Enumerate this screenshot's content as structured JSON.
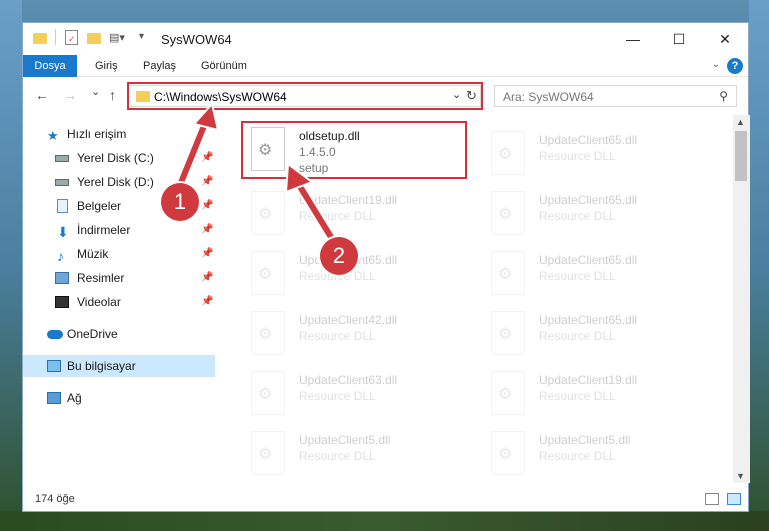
{
  "window": {
    "title": "SysWOW64",
    "minimize": "—",
    "maximize": "☐",
    "close": "✕"
  },
  "ribbon": {
    "tabs": [
      "Dosya",
      "Giriş",
      "Paylaş",
      "Görünüm"
    ],
    "help": "?"
  },
  "nav": {
    "back": "←",
    "forward": "→",
    "recent": "⌄",
    "up": "↑",
    "address": "C:\\Windows\\SysWOW64",
    "address_dropdown": "⌄",
    "refresh": "↻",
    "search_placeholder": "Ara: SysWOW64",
    "search_icon": "⚲"
  },
  "sidebar": {
    "items": [
      {
        "label": "Hızlı erişim",
        "icon": "star-icon"
      },
      {
        "label": "Yerel Disk (C:)",
        "icon": "drive-icon",
        "pinned": true
      },
      {
        "label": "Yerel Disk (D:)",
        "icon": "drive-icon",
        "pinned": true
      },
      {
        "label": "Belgeler",
        "icon": "documents-icon",
        "pinned": true
      },
      {
        "label": "İndirmeler",
        "icon": "downloads-icon",
        "pinned": true
      },
      {
        "label": "Müzik",
        "icon": "music-icon",
        "pinned": true
      },
      {
        "label": "Resimler",
        "icon": "pictures-icon",
        "pinned": true
      },
      {
        "label": "Videolar",
        "icon": "videos-icon",
        "pinned": true
      },
      {
        "label": "OneDrive",
        "icon": "cloud-icon"
      },
      {
        "label": "Bu bilgisayar",
        "icon": "computer-icon",
        "selected": true
      },
      {
        "label": "Ağ",
        "icon": "network-icon"
      }
    ]
  },
  "files": {
    "highlighted": {
      "name": "oldsetup.dll",
      "version": "1.4.5.0",
      "description": "setup"
    },
    "left_column": [
      {
        "name": "UpdateClient19.dll",
        "desc": "Resource DLL"
      },
      {
        "name": "UpdateClient65.dll",
        "desc": "Resource DLL"
      },
      {
        "name": "UpdateClient42.dll",
        "desc": "Resource DLL"
      },
      {
        "name": "UpdateClient63.dll",
        "desc": "Resource DLL"
      },
      {
        "name": "UpdateClient5.dll",
        "desc": "Resource DLL"
      }
    ],
    "right_column": [
      {
        "name": "UpdateClient65.dll",
        "desc": "Resource DLL"
      },
      {
        "name": "UpdateClient65.dll",
        "desc": "Resource DLL"
      },
      {
        "name": "UpdateClient65.dll",
        "desc": "Resource DLL"
      },
      {
        "name": "UpdateClient65.dll",
        "desc": "Resource DLL"
      },
      {
        "name": "UpdateClient19.dll",
        "desc": "Resource DLL"
      },
      {
        "name": "UpdateClient5.dll",
        "desc": "Resource DLL"
      }
    ]
  },
  "status": {
    "count": "174 öğe"
  },
  "markers": [
    "1",
    "2"
  ],
  "colors": {
    "accent": "#1979ca",
    "highlight": "#d0313a",
    "selection": "#cce8ff"
  }
}
